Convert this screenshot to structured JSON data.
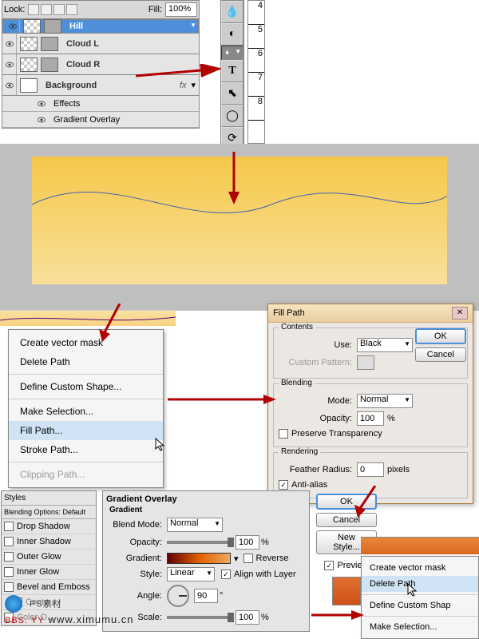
{
  "layersPanel": {
    "lockLabel": "Lock:",
    "fillLabel": "Fill:",
    "fillValue": "100%",
    "layers": [
      {
        "name": "Hill",
        "selected": true
      },
      {
        "name": "Cloud L"
      },
      {
        "name": "Cloud R"
      },
      {
        "name": "Background",
        "fx": "fx",
        "white": true
      }
    ],
    "effects": "Effects",
    "gradOverlay": "Gradient Overlay"
  },
  "ruler": [
    "4",
    "5",
    "6",
    "7",
    "8"
  ],
  "contextMenu": {
    "items": [
      "Create vector mask",
      "Delete Path",
      "Define Custom Shape...",
      "Make Selection...",
      "Fill Path...",
      "Stroke Path...",
      "Clipping Path..."
    ],
    "highlight": "Fill Path..."
  },
  "fillPath": {
    "title": "Fill Path",
    "contents": "Contents",
    "useLabel": "Use:",
    "useValue": "Black",
    "customPattern": "Custom Pattern:",
    "blending": "Blending",
    "modeLabel": "Mode:",
    "modeValue": "Normal",
    "opacityLabel": "Opacity:",
    "opacityValue": "100",
    "pct": "%",
    "preserve": "Preserve Transparency",
    "rendering": "Rendering",
    "featherLabel": "Feather Radius:",
    "featherValue": "0",
    "pixels": "pixels",
    "aa": "Anti-alias",
    "ok": "OK",
    "cancel": "Cancel"
  },
  "stylesPanel": {
    "title": "Styles",
    "blendDefault": "Blending Options: Default",
    "opts": [
      "Drop Shadow",
      "Inner Shadow",
      "Outer Glow",
      "Inner Glow",
      "Bevel and Emboss",
      "Contour",
      "Color O..."
    ]
  },
  "gradientOverlay": {
    "title": "Gradient Overlay",
    "section": "Gradient",
    "blendMode": "Blend Mode:",
    "blendValue": "Normal",
    "opacity": "Opacity:",
    "opacityValue": "100",
    "gradient": "Gradient:",
    "reverse": "Reverse",
    "style": "Style:",
    "styleValue": "Linear",
    "align": "Align with Layer",
    "angle": "Angle:",
    "angleValue": "90",
    "deg": "°",
    "scale": "Scale:",
    "scaleValue": "100",
    "pct": "%"
  },
  "buttons": {
    "ok": "OK",
    "cancel": "Cancel",
    "newStyle": "New Style...",
    "preview": "Preview"
  },
  "miniMenu": {
    "items": [
      "Create vector mask",
      "Delete Path",
      "Define Custom Shap",
      "Make Selection..."
    ],
    "highlight": "Delete Path"
  },
  "watermark": {
    "text": "PS素材",
    "url": "www.ximumu.cn",
    "bbs": "BBS.   YY"
  }
}
